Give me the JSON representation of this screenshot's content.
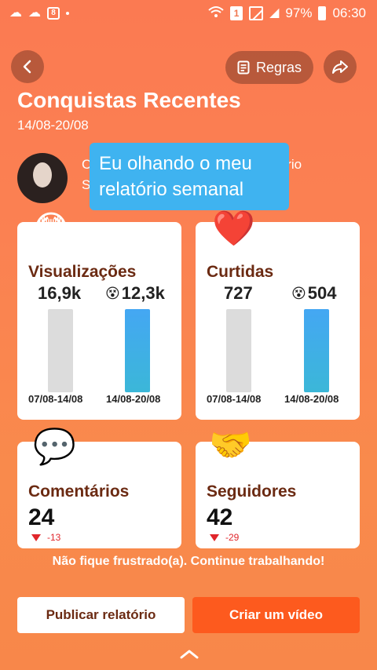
{
  "status_bar": {
    "battery": "97%",
    "time": "06:30",
    "sim_label": "1"
  },
  "header": {
    "rules_label": "Regras",
    "title": "Conquistas Recentes",
    "date_range": "14/08-20/08"
  },
  "profile": {
    "visible_line1_start": "C",
    "visible_line1_end": "ório",
    "visible_line2_start": "S"
  },
  "overlay_caption": "Eu olhando o meu relatório  semanal",
  "cards": {
    "views": {
      "title": "Visualizações",
      "prev_value": "16,9k",
      "curr_value": "12,3k",
      "prev_label": "07/08-14/08",
      "curr_label": "14/08-20/08",
      "emoji": "😳",
      "value_emoji": "😵"
    },
    "likes": {
      "title": "Curtidas",
      "prev_value": "727",
      "curr_value": "504",
      "prev_label": "07/08-14/08",
      "curr_label": "14/08-20/08",
      "emoji": "❤️",
      "value_emoji": "😵"
    },
    "comments": {
      "title": "Comentários",
      "value": "24",
      "delta": "-13",
      "emoji": "💬"
    },
    "followers": {
      "title": "Seguidores",
      "value": "42",
      "delta": "-29",
      "emoji": "🤝"
    }
  },
  "motivation": "Não fique frustrado(a). Continue trabalhando!",
  "buttons": {
    "publish": "Publicar relatório",
    "create": "Criar um vídeo"
  },
  "colors": {
    "accent": "#fd5a1e",
    "title_brown": "#6b2a12",
    "bar_current": "#44a7f3",
    "bar_previous": "#dcdcdc",
    "caption_blue": "#3fb3f0"
  }
}
